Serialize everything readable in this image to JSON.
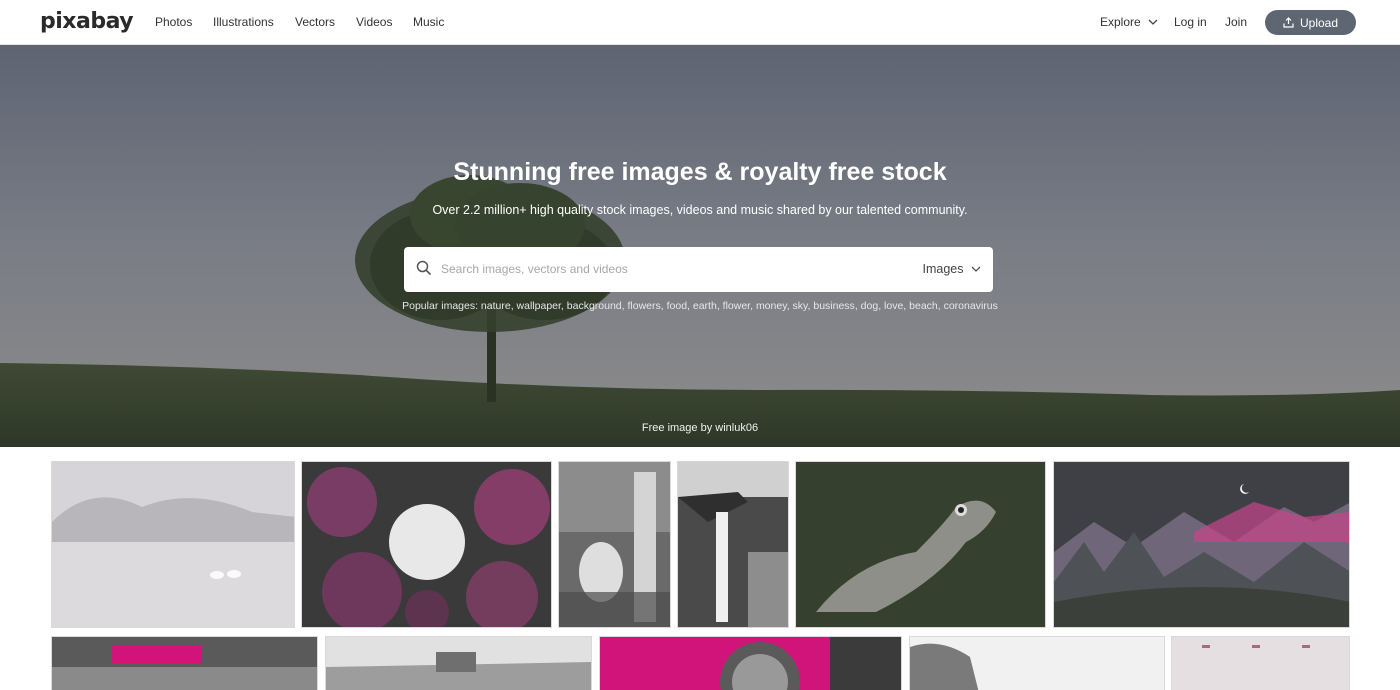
{
  "nav": {
    "logo": "pixabay",
    "links": [
      "Photos",
      "Illustrations",
      "Vectors",
      "Videos",
      "Music"
    ],
    "explore": "Explore",
    "login": "Log in",
    "join": "Join",
    "upload": "Upload"
  },
  "hero": {
    "title": "Stunning free images & royalty free stock",
    "subtitle": "Over 2.2 million+ high quality stock images, videos and music shared by our talented community.",
    "search": {
      "placeholder": "Search images, vectors and videos",
      "type": "Images"
    },
    "popular_label": "Popular images:",
    "popular_tags": [
      "nature",
      "wallpaper",
      "background",
      "flowers",
      "food",
      "earth",
      "flower",
      "money",
      "sky",
      "business",
      "dog",
      "love",
      "beach",
      "coronavirus"
    ],
    "credit": "Free image by winluk06"
  },
  "colors": {
    "upload_button": "#5e6672",
    "accent_pink": "#d1147a",
    "nav_border": "#e6e6e6"
  },
  "icons": [
    "search-icon",
    "chevron-down-icon",
    "upload-icon"
  ]
}
